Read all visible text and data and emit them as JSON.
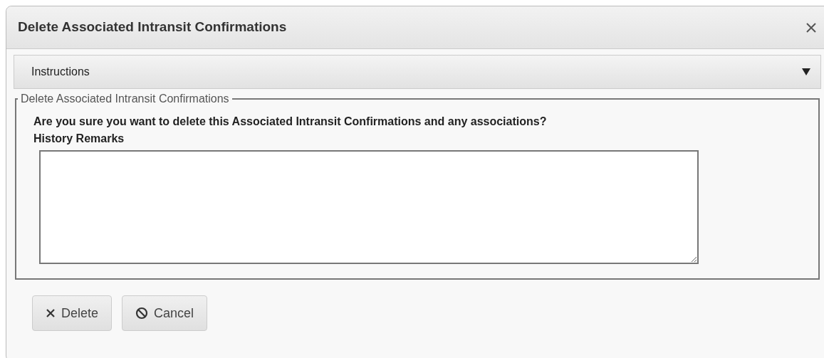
{
  "dialog": {
    "title": "Delete Associated Intransit Confirmations"
  },
  "instructions": {
    "label": "Instructions",
    "expanded": false
  },
  "fieldset": {
    "legend": "Delete Associated Intransit Confirmations",
    "question": "Are you sure you want to delete this Associated Intransit Confirmations and any associations?",
    "field_label": "History Remarks"
  },
  "buttons": [
    {
      "label": "Delete",
      "kind": "delete"
    },
    {
      "label": "Cancel",
      "kind": "cancel"
    }
  ]
}
